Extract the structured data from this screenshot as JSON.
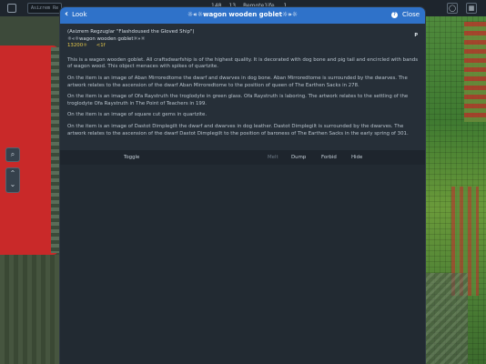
{
  "top_bar": {
    "search_value": "Asizrem Re",
    "stat_1": "148",
    "stat_2": "13",
    "stat_3": "Remote1ife,",
    "stat_4": "1"
  },
  "dialog": {
    "back_label": "Look",
    "title": "☼«☼wagon wooden goblet☼»☼",
    "help_label": "?",
    "close_label": "Close",
    "p_badge": "P",
    "item": {
      "nickname": "(Asizrem Regzuglar \"Flashdoused the Gloved Ship\")",
      "name_line": "☼«☼wagon wooden goblet☼»☼",
      "value": "13200☼",
      "age": "<1f"
    },
    "paragraphs": [
      "This is a wagon wooden goblet. All craftsdwarfship is of the highest quality. It is decorated with dog bone and pig tail and encircled with bands of wagon wood. This object menaces with spikes of quartzite.",
      "On the item is an image of Aban Mirroredtome the dwarf and dwarves in dog bone. Aban Mirroredtome is surrounded by the dwarves. The artwork relates to the ascension of the dwarf Aban Mirroredtome to the position of queen of The Earthen Sacks in 278.",
      "On the item is an image of Ofa Raystruth the troglodyte in green glass. Ofa Raystruth is laboring. The artwork relates to the settling of the troglodyte Ofa Raystruth in The Point of Teachers in 199.",
      "On the item is an image of square cut gems in quartzite.",
      "On the item is an image of Dastot Dimplegilt the dwarf and dwarves in dog leather. Dastot Dimplegilt is surrounded by the dwarves. The artwork relates to the ascension of the dwarf Dastot Dimplegilt to the position of baroness of The Earthen Sacks in the early spring of 301."
    ],
    "actions": {
      "toggle": "Toggle",
      "melt": "Melt",
      "dump": "Dump",
      "forbid": "Forbid",
      "hide": "Hide"
    }
  },
  "colors": {
    "header_blue": "#2f72c9",
    "dialog_bg": "#222a32",
    "value_gold": "#e6c84a",
    "map_red": "#c92929",
    "map_green": "#4f8a3c"
  }
}
